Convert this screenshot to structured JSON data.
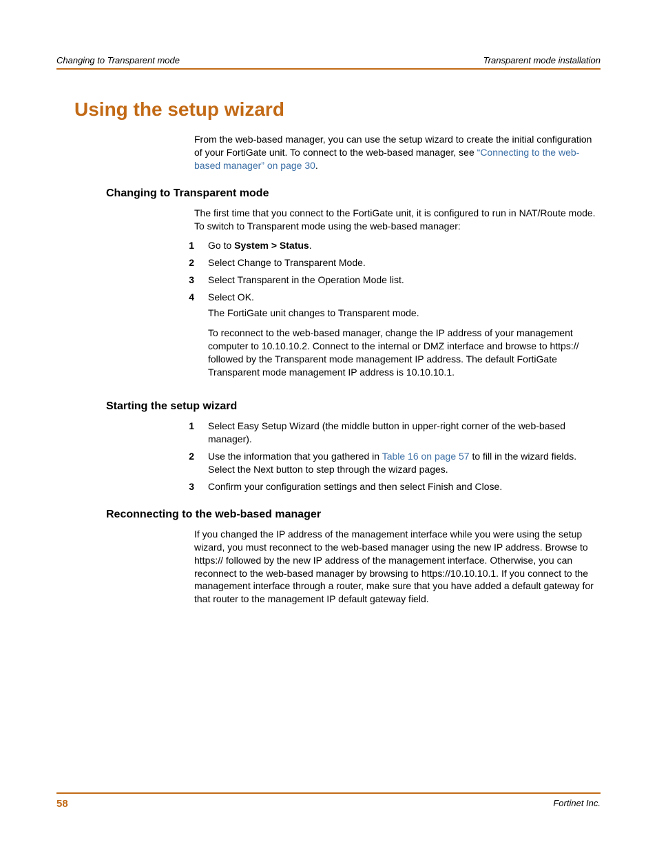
{
  "header": {
    "left": "Changing to Transparent mode",
    "right": "Transparent mode installation"
  },
  "h1": "Using the setup wizard",
  "intro": {
    "p1": "From the web-based manager, you can use the setup wizard to create the initial configuration of your FortiGate unit. To connect to the web-based manager, see ",
    "link": "“Connecting to the web-based manager” on page 30",
    "period": "."
  },
  "sec1": {
    "heading": "Changing to Transparent mode",
    "intro": "The first time that you connect to the FortiGate unit, it is configured to run in NAT/Route mode. To switch to Transparent mode using the web-based manager:",
    "steps": [
      {
        "n": "1",
        "line_pre": "Go to ",
        "bold": "System > Status",
        "line_post": "."
      },
      {
        "n": "2",
        "line": "Select Change to Transparent Mode."
      },
      {
        "n": "3",
        "line": "Select Transparent in the Operation Mode list."
      },
      {
        "n": "4",
        "line": "Select OK.",
        "sub1": "The FortiGate unit changes to Transparent mode.",
        "sub2": "To reconnect to the web-based manager, change the IP address of your management computer to 10.10.10.2. Connect to the internal or DMZ interface and browse to https:// followed by the Transparent mode management IP address. The default FortiGate Transparent mode management IP address is 10.10.10.1."
      }
    ]
  },
  "sec2": {
    "heading": "Starting the setup wizard",
    "steps": [
      {
        "n": "1",
        "line": "Select Easy Setup Wizard (the middle button in upper-right corner of the web-based manager)."
      },
      {
        "n": "2",
        "pre": "Use the information that you gathered in ",
        "link": "Table 16 on page 57",
        "post": " to fill in the wizard fields. Select the Next button to step through the wizard pages."
      },
      {
        "n": "3",
        "line": "Confirm your configuration settings and then select Finish and Close."
      }
    ]
  },
  "sec3": {
    "heading": "Reconnecting to the web-based manager",
    "body": "If you changed the IP address of the management interface while you were using the setup wizard, you must reconnect to the web-based manager using the new IP address. Browse to https:// followed by the new IP address of the management interface. Otherwise, you can reconnect to the web-based manager by browsing to https://10.10.10.1. If you connect to the management interface through a router, make sure that you have added a default gateway for that router to the management IP default gateway field."
  },
  "footer": {
    "page": "58",
    "company": "Fortinet Inc."
  }
}
